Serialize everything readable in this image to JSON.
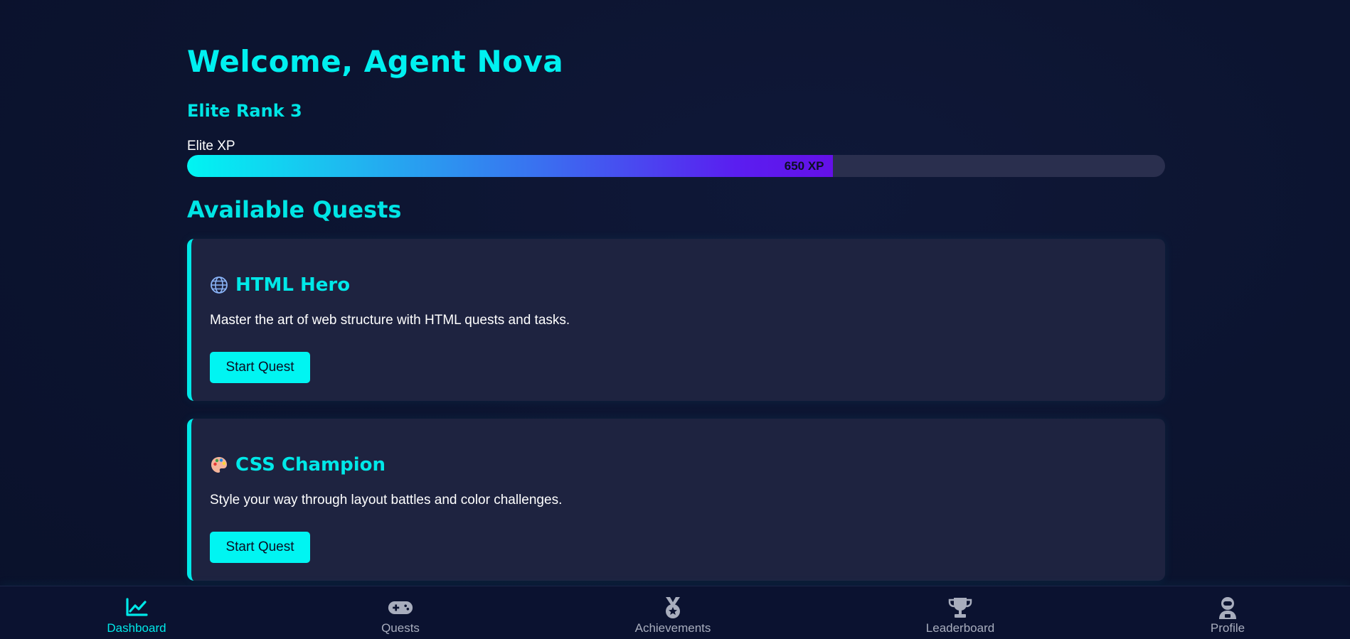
{
  "header": {
    "welcome": "Welcome, Agent Nova",
    "rank": "Elite Rank 3"
  },
  "xp": {
    "label": "Elite XP",
    "value_text": "650 XP",
    "progress_fraction": 0.66
  },
  "quests_section": {
    "title": "Available Quests",
    "items": [
      {
        "icon": "globe-icon",
        "name": "HTML Hero",
        "description": "Master the art of web structure with HTML quests and tasks.",
        "button": "Start Quest"
      },
      {
        "icon": "palette-icon",
        "name": "CSS Champion",
        "description": "Style your way through layout battles and color challenges.",
        "button": "Start Quest"
      }
    ]
  },
  "nav": {
    "items": [
      {
        "icon": "chart-line-icon",
        "label": "Dashboard",
        "active": true
      },
      {
        "icon": "gamepad-icon",
        "label": "Quests",
        "active": false
      },
      {
        "icon": "medal-icon",
        "label": "Achievements",
        "active": false
      },
      {
        "icon": "trophy-icon",
        "label": "Leaderboard",
        "active": false
      },
      {
        "icon": "astronaut-icon",
        "label": "Profile",
        "active": false
      }
    ]
  },
  "colors": {
    "accent": "#00f0f0",
    "background": "#0c1430",
    "card": "#1e2340",
    "nav_inactive": "#a8adbd"
  }
}
